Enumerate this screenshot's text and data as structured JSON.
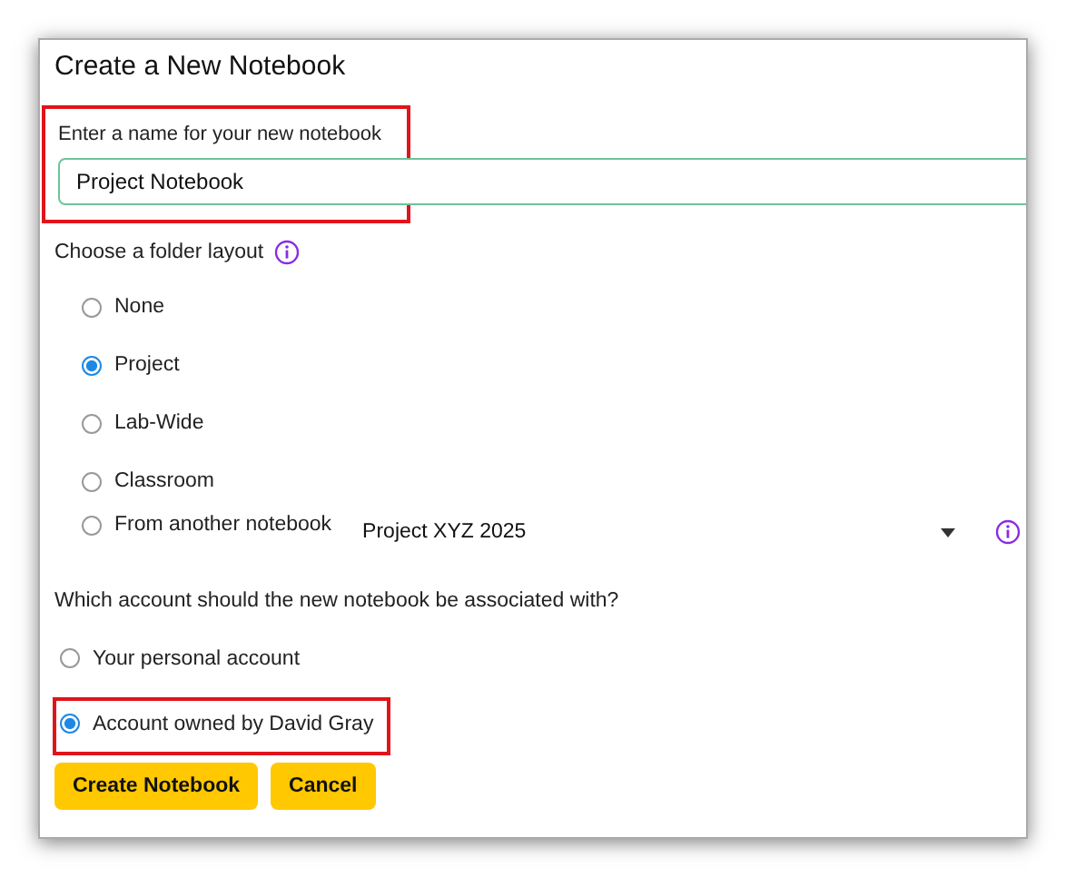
{
  "dialog": {
    "title": "Create a New Notebook"
  },
  "name_field": {
    "label": "Enter a name for your new notebook",
    "value": "Project Notebook",
    "highlighted": true
  },
  "folder_layout": {
    "label": "Choose a folder layout",
    "options": [
      {
        "label": "None",
        "selected": false
      },
      {
        "label": "Project",
        "selected": true
      },
      {
        "label": "Lab-Wide",
        "selected": false
      },
      {
        "label": "Classroom",
        "selected": false
      },
      {
        "label": "From another notebook",
        "selected": false,
        "kind": "dropdown",
        "dropdown_value": "Project XYZ 2025"
      }
    ]
  },
  "account": {
    "label": "Which account should the new notebook be associated with?",
    "options": [
      {
        "label": "Your personal account",
        "selected": false,
        "highlighted": false
      },
      {
        "label": "Account owned by David Gray",
        "selected": true,
        "highlighted": true
      }
    ]
  },
  "buttons": [
    "Create Notebook",
    "Cancel"
  ]
}
